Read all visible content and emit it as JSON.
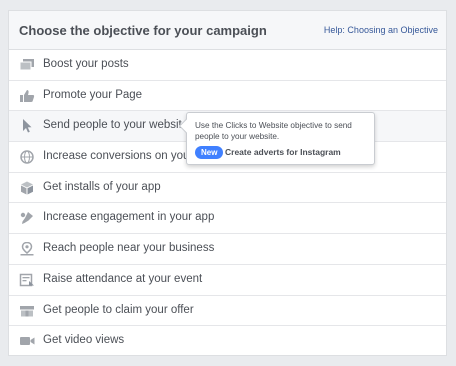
{
  "header": {
    "title": "Choose the objective for your campaign",
    "help_link": "Help: Choosing an Objective"
  },
  "objectives": [
    {
      "label": "Boost your posts",
      "icon": "posts-icon"
    },
    {
      "label": "Promote your Page",
      "icon": "thumbs-up-icon"
    },
    {
      "label": "Send people to your website",
      "icon": "cursor-icon"
    },
    {
      "label": "Increase conversions on your w",
      "icon": "globe-icon"
    },
    {
      "label": "Get installs of your app",
      "icon": "box-icon"
    },
    {
      "label": "Increase engagement in your app",
      "icon": "gamepad-icon"
    },
    {
      "label": "Reach people near your business",
      "icon": "location-pin-icon"
    },
    {
      "label": "Raise attendance at your event",
      "icon": "calendar-icon"
    },
    {
      "label": "Get people to claim your offer",
      "icon": "offer-tag-icon"
    },
    {
      "label": "Get video views",
      "icon": "video-camera-icon"
    }
  ],
  "tooltip": {
    "text": "Use the Clicks to Website objective to send people to your website.",
    "badge": "New",
    "link": "Create adverts for Instagram"
  },
  "colors": {
    "icon_gray": "#a1a5ab",
    "badge_blue": "#4080ff",
    "link_blue": "#365899"
  }
}
